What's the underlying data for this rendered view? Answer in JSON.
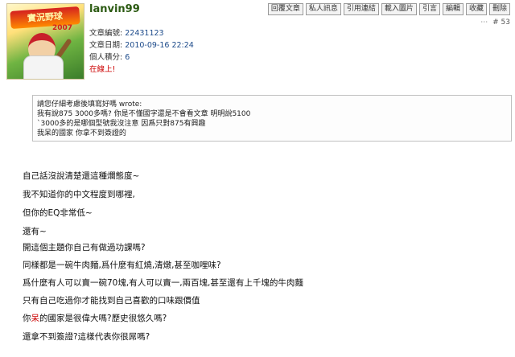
{
  "user": {
    "name": "lanvin99",
    "avatar_text": "實況野球",
    "avatar_year": "2007",
    "post_id_label": "文章編號:",
    "post_id": "22431123",
    "date_label": "文章日期:",
    "date": "2010-09-16 22:24",
    "score_label": "個人積分:",
    "score": "6",
    "online": "在線上!"
  },
  "toolbar": {
    "reply": "回覆文章",
    "pm": "私人訊息",
    "link": "引用連結",
    "image": "載入圖片",
    "quote": "引言",
    "edit": "編輯",
    "favorite": "收藏",
    "delete": "刪除"
  },
  "post_index": "# 53",
  "quote": {
    "header": "請您仔細考慮後填寫好嗎 wrote:",
    "lines": [
      "我有說875 3000多嗎? 你是不懂國字還是不會看文章 明明說5100",
      "`3000多的是哪個型號我沒注意 因爲只對875有興趣",
      "我呆的國家 你拿不到簽證的"
    ]
  },
  "body": {
    "l1": "自己話沒說清楚還這種爛態度~",
    "l2": "我不知道你的中文程度到哪裡,",
    "l3": "但你的EQ非常低~",
    "l4": "還有~",
    "l5": "開這個主題你自己有做過功課嗎?",
    "l6": "同樣都是一碗牛肉麵,爲什麼有紅燒,清燉,甚至咖哩味?",
    "l7": "爲什麼有人可以賣一碗70塊,有人可以賣一,兩百塊,甚至還有上千塊的牛肉麵",
    "l8": "只有自己吃過你才能找到自己喜歡的口味跟價值",
    "l9a": "你",
    "l9b": "呆",
    "l9c": "的國家是很偉大嗎?歷史很悠久嗎?",
    "l10": "還拿不到簽證?這樣代表你很屌嗎?"
  }
}
